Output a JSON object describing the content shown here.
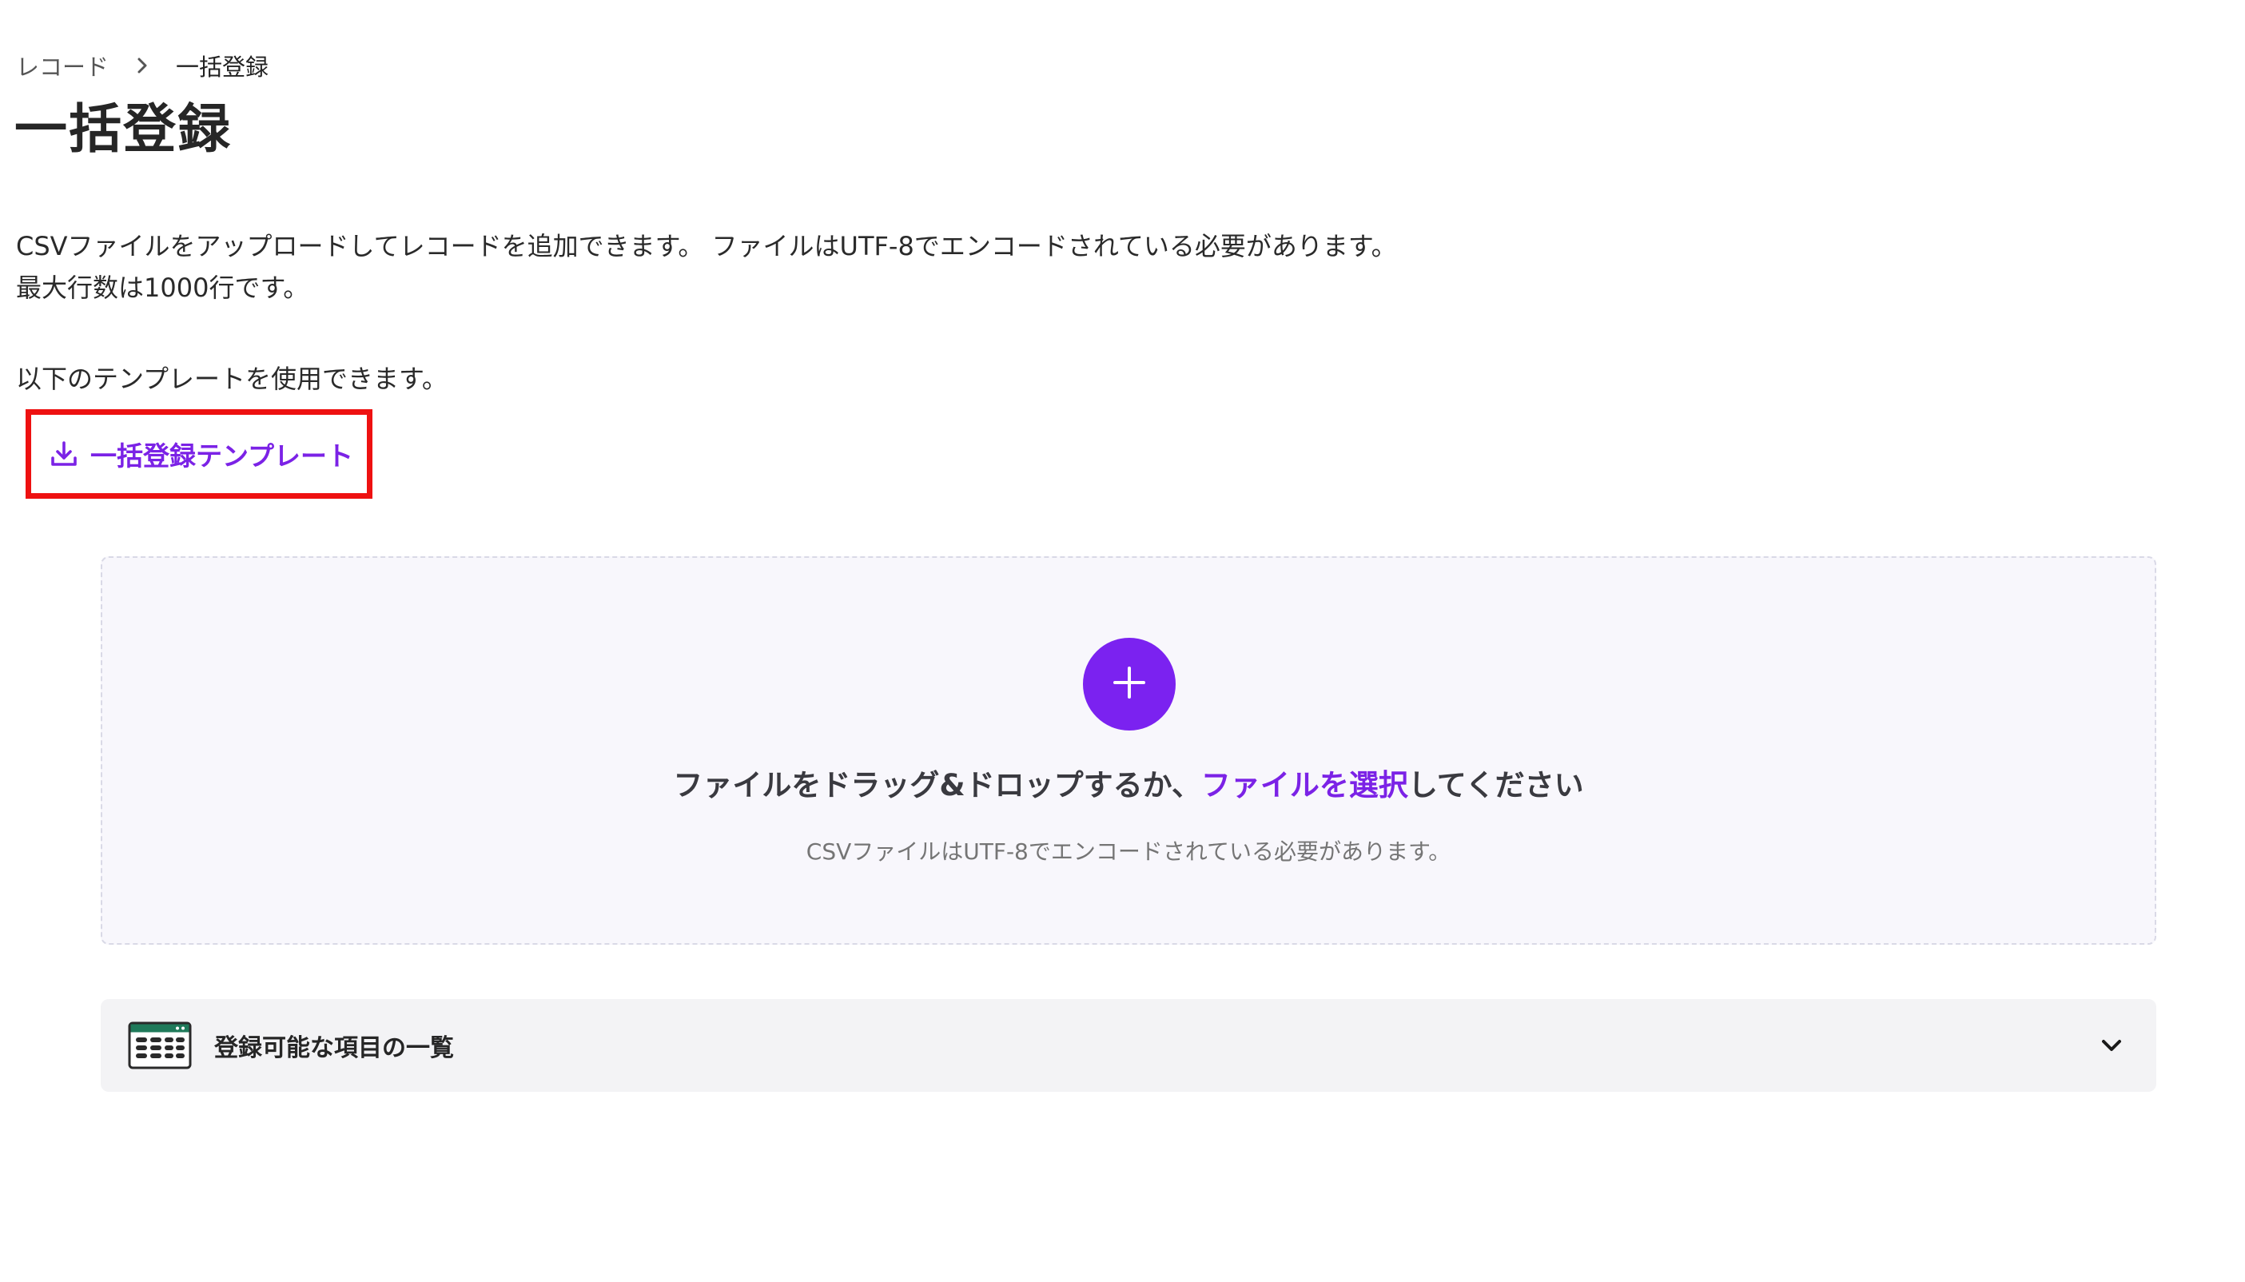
{
  "breadcrumb": {
    "parent": "レコード",
    "current": "一括登録"
  },
  "page_title": "一括登録",
  "description": {
    "line1": "CSVファイルをアップロードしてレコードを追加できます。 ファイルはUTF-8でエンコードされている必要があります。",
    "line2": "最大行数は1000行です。"
  },
  "template_note": "以下のテンプレートを使用できます。",
  "template_link": {
    "label": "一括登録テンプレート",
    "icon": "download-icon"
  },
  "dropzone": {
    "main_before": "ファイルをドラッグ&ドロップするか、",
    "select_link": "ファイルを選択",
    "main_after": "してください",
    "sub": "CSVファイルはUTF-8でエンコードされている必要があります。",
    "icon": "plus-icon"
  },
  "accordion": {
    "label": "登録可能な項目の一覧",
    "icon": "table-icon",
    "toggle_icon": "chevron-down-icon"
  },
  "colors": {
    "accent": "#7b22f0",
    "highlight_border": "#ee1111",
    "dropzone_bg": "#f8f7fc",
    "accordion_bg": "#f3f3f5",
    "table_icon_green": "#1f7a5a"
  }
}
